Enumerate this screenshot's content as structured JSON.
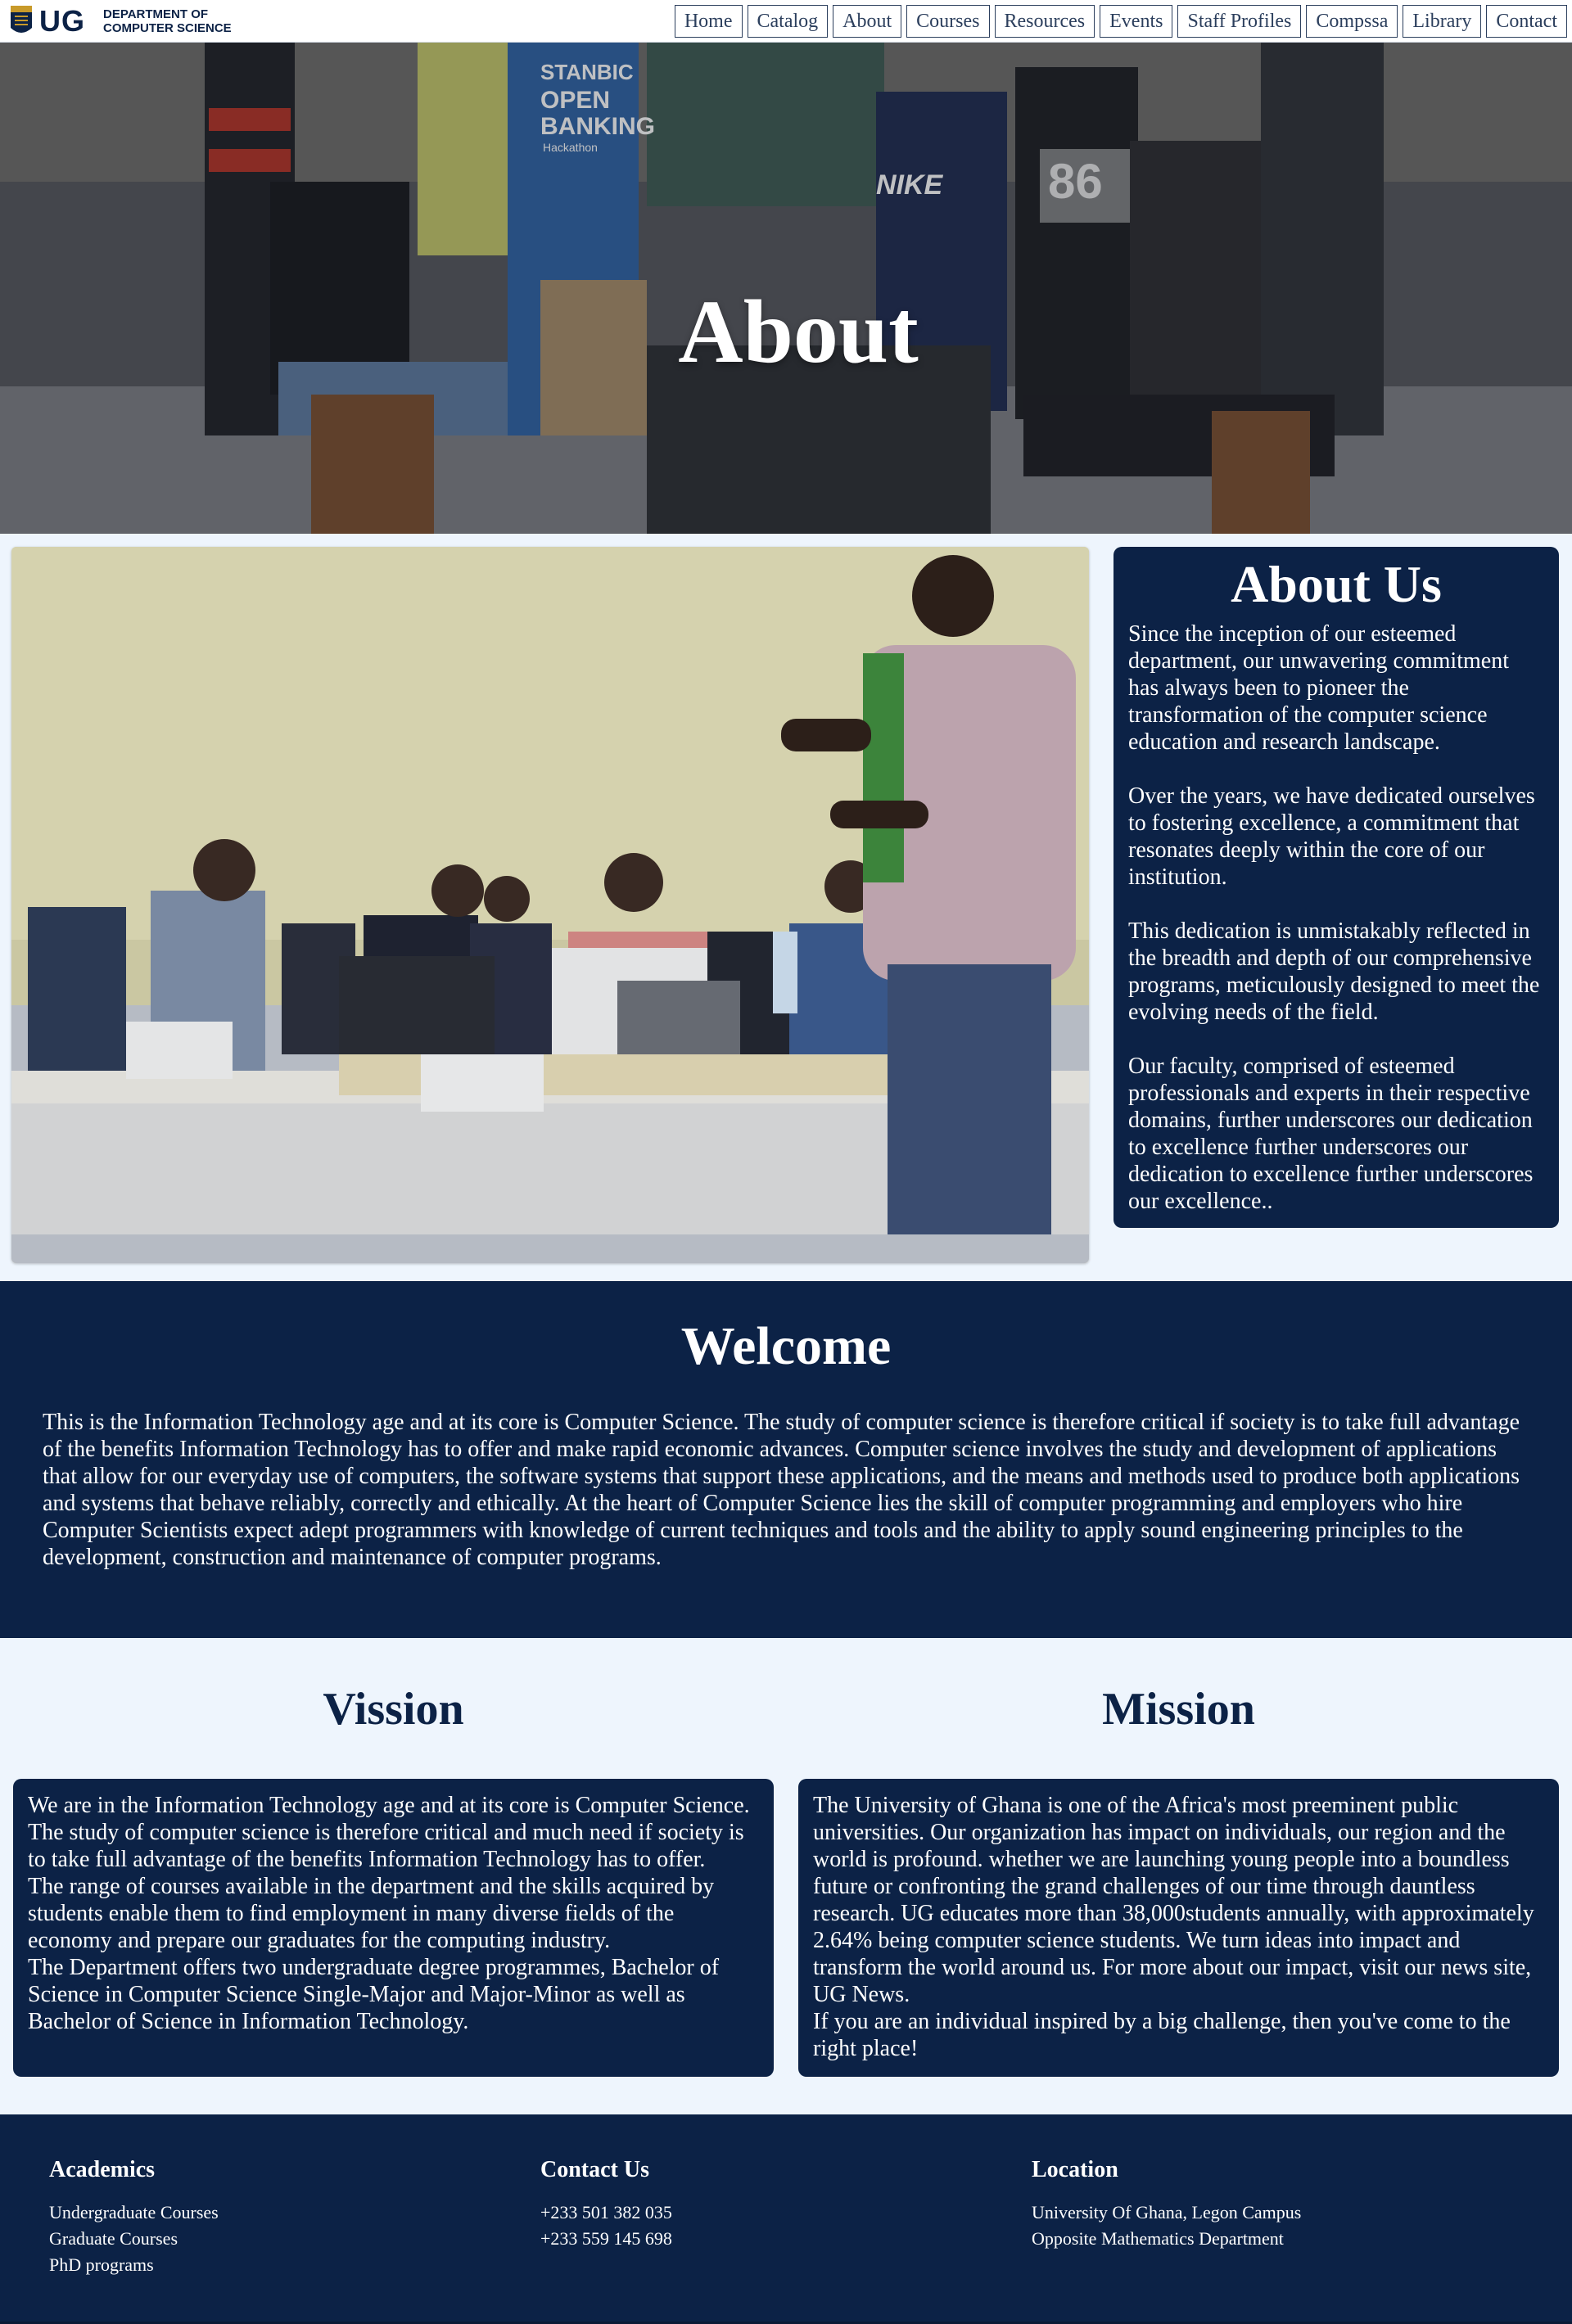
{
  "brand": {
    "logo_text": "UG",
    "dept_line1": "DEPARTMENT OF",
    "dept_line2": "COMPUTER SCIENCE"
  },
  "nav": {
    "items": [
      "Home",
      "Catalog",
      "About",
      "Courses",
      "Resources",
      "Events",
      "Staff Profiles",
      "Compssa",
      "Library",
      "Contact"
    ]
  },
  "hero": {
    "title": "About",
    "banner_text": [
      "STANBIC",
      "OPEN",
      "BANKING",
      "Hackathon"
    ],
    "shirt_text": [
      "NIKE",
      "86"
    ]
  },
  "about": {
    "heading": "About Us",
    "paragraphs": [
      "Since the inception of our esteemed department, our unwavering commitment has always been to pioneer the transformation of the computer science education and research landscape.",
      "Over the years, we have dedicated ourselves to fostering excellence, a commitment that resonates deeply within the core of our institution.",
      "This dedication is unmistakably reflected in the breadth and depth of our comprehensive programs, meticulously designed to meet the evolving needs of the field.",
      "Our faculty, comprised of esteemed professionals and experts in their respective domains, further underscores our dedication to excellence further underscores our dedication to excellence further underscores our excellence.."
    ]
  },
  "welcome": {
    "heading": "Welcome",
    "body": "This is the Information Technology age and at its core is Computer Science. The study of computer science is therefore critical if society is to take full advantage of the benefits Information Technology has to offer and make rapid economic advances. Computer science involves the study and development of applications that allow for our everyday use of computers, the software systems that support these applications, and the means and methods used to produce both applications and systems that behave reliably, correctly and ethically. At the heart of Computer Science lies the skill of computer programming and employers who hire Computer Scientists expect adept programmers with knowledge of current techniques and tools and the ability to apply sound engineering principles to the development, construction and maintenance of computer programs."
  },
  "vision": {
    "heading": "Vission",
    "paragraphs": [
      "We are in the Information Technology age and at its core is Computer Science. The study of computer science is therefore critical and much need if society is to take full advantage of the benefits Information Technology has to offer.",
      "The range of courses available in the department and the skills acquired by students enable them to find employment in many diverse fields of the economy and prepare our graduates for the computing industry.",
      "The Department offers two undergraduate degree programmes, Bachelor of Science in Computer Science Single-Major and Major-Minor as well as Bachelor of Science in Information Technology."
    ]
  },
  "mission": {
    "heading": "Mission",
    "paragraphs": [
      "The University of Ghana is one of the Africa's most preeminent public universities. Our organization has impact on individuals, our region and the world is profound. whether we are launching young people into a boundless future or confronting the grand challenges of our time through dauntless research. UG educates more than 38,000students annually, with approximately 2.64% being computer science students. We turn ideas into impact and transform the world around us. For more about our impact, visit our news site, UG News.",
      "If you are an individual inspired by a big challenge, then you've come to the right place!"
    ]
  },
  "footer": {
    "academics": {
      "heading": "Academics",
      "items": [
        "Undergraduate Courses",
        "Graduate Courses",
        "PhD programs"
      ]
    },
    "contact": {
      "heading": "Contact Us",
      "items": [
        "+233 501 382 035",
        "+233 559 145 698"
      ]
    },
    "location": {
      "heading": "Location",
      "items": [
        "University Of Ghana, Legon Campus",
        "Opposite Mathematics Department"
      ]
    }
  },
  "colors": {
    "navy": "#0c2246",
    "page_bg": "#eef5fd",
    "nav_border": "#2c3f5d",
    "white": "#ffffff"
  },
  "icons": {
    "crest": "university-crest-icon"
  }
}
